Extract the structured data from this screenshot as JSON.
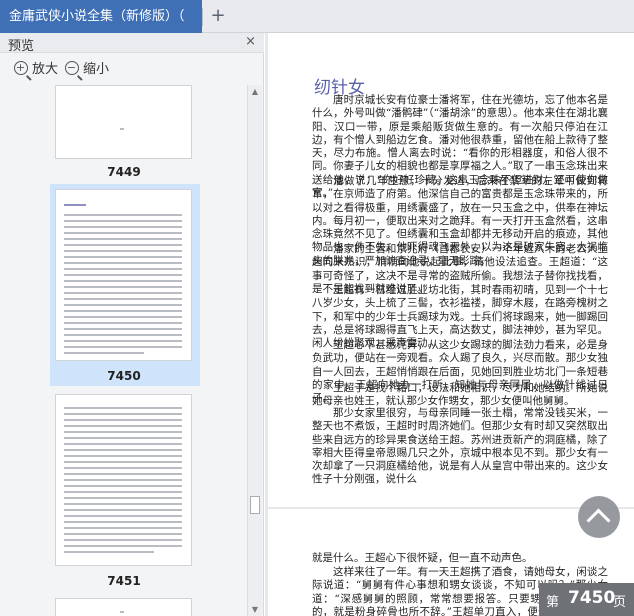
{
  "tab": {
    "title": "金庸武侠小说全集（新修版）（",
    "new_tab_label": "+"
  },
  "preview": {
    "title": "预览",
    "close_label": "×",
    "zoom_in_label": "放大",
    "zoom_out_label": "缩小",
    "thumbnails": [
      {
        "label": "7449",
        "selected": false
      },
      {
        "label": "7450",
        "selected": true
      },
      {
        "label": "7451",
        "selected": false
      }
    ]
  },
  "document": {
    "chapter_title": "纫针女",
    "paragraphs": [
      "唐时京城长安有位豪士潘将军，住在光德坊，忘了他本名是什么，外号叫做“潘鹘硉”（“潘胡涂”的意思）。他本来住在湖北襄阳、汉口一带，原是乘船贩货做生意的。有一次船只停泊在江边，有个憎人到船边乞食。潘对他很恭重，留他在船上款待了整天，尽力布施。憎人离去时说：“看你的形相器度，和俗人很不同。你妻子儿女的相貌也都是享厚福之人。”取了一串玉念珠出来送给他，说：“你好好珍藏。这串玉念珠不但进财，还可使你做官。”",
      "潘做了几年生意，十分发达，后来在禁军的左军中做到将军，在京师造了府第。他深信自己的富贵都是玉念珠带来的，所以对之看得极重，用绣囊盛了，放在一只玉盒之中，供奉在神坛内。每月初一，便取出来对之跪拜。有一天打开玉盒然看，这串念珠竟然不见了。但绣囊和玉盒却都并无移动开启的痕迹，其他物品也一件不失。他吓得魂飞天外，以为这是破家失官、大祸临头的朕兆，严加访查追寻，毫无影踪。",
      "潘家的主管和京兆府（首都长安）一个年近八十的老公人王超向来熟识，悄悄向他说起此事，请他设法追查。王超道：“这事可奇怪了，这决不是寻常的盗贼所偷。我想法子替你找找看，是不是能找到就难说了。”",
      "王超有一日经过胜业坊北街，其时春雨初晴，见到一个十七八岁少女，头上梳了三髻，衣衫褴褛，脚穿木屐，在路旁槐树之下，和军中的少年士兵踢球为戏。士兵们将球踢来，她一脚踢回去，总是将球踢得直飞上天，高达数丈，脚法神妙，甚为罕见。闲人纷纷聚观，采声雷动。",
      "王超心下甚感诧异，从这少女踢球的脚法劲力看来，必是身负武功，便站在一旁观看。众人踢了良久，兴尽而散。那少女独自一人回去，王超悄悄跟在后面，见她回到胜业坊北门一条短巷的家中。王超向她办一打听，知她与母亲同居，以做针线过日子。",
      "王超于是找个藉口，设法和她相识，尽力和她结纳。所她说她母亲也姓王，就认那少女作甥女，那少女便叫他舅舅。",
      "那少女家里很穷，与母亲同睡一张土榻，常常没钱买米，一整天也不煮饭，王超时时周济她们。但那少女有时却又突然取出些来自远方的珍异果食送给王超。苏州进贡新产的洞庭橘，除了宰相大臣得皇帝恩赐几只之外，京城中根本见不到。那少女有一次却拿了一只洞庭橘给他，说是有人从皇宫中带出来的。这少女性子十分刚强，说什么"
    ],
    "page2_paragraphs": [
      "就是什么。王超心下很怀疑，但一直不动声色。",
      "这样来往了一年。有一天王超携了酒食，请她母女，闲谈之际说道：“舅舅有件心事想和甥女谈谈，不知可以吗？”那少女道：“深感舅舅的照顾，常常想要报答。只要甥女力量及得到的，就是粉身碎骨也所不辞。”王超单刀直入，便道：“潘将军失了一串玉念珠，不知甥女有没有听到什么讯息？”那少女微笑道：“我怎么会知道？”"
    ]
  },
  "page_indicator": {
    "prefix": "第",
    "number": "7450",
    "suffix": "页"
  }
}
